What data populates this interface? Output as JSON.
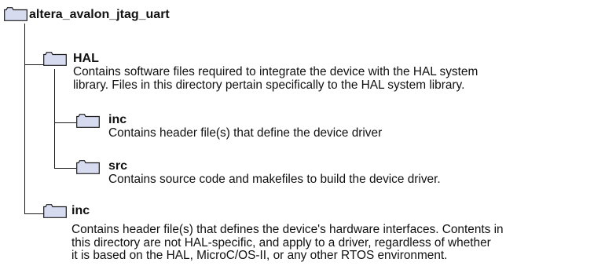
{
  "tree": {
    "root": {
      "title": "altera_avalon_jtag_uart",
      "icon": "folder-icon"
    },
    "hal": {
      "title": "HAL",
      "icon": "folder-icon",
      "desc": [
        "Contains software files required to integrate the device with the HAL system",
        "library.  Files in this directory pertain specifically to the HAL system library."
      ]
    },
    "hal_inc": {
      "title": "inc",
      "icon": "folder-icon",
      "desc": [
        "Contains header file(s) that define the device driver"
      ]
    },
    "hal_src": {
      "title": "src",
      "icon": "folder-icon",
      "desc": [
        "Contains source code and makefiles to build the device driver."
      ]
    },
    "inc": {
      "title": "inc",
      "icon": "folder-icon",
      "desc": [
        "Contains header file(s) that defines the device's hardware interfaces.  Contents in",
        "this directory are not HAL-specific, and apply to a driver, regardless of whether",
        "it is based on the HAL, MicroC/OS-II, or any other RTOS environment."
      ]
    }
  },
  "colors": {
    "folder_fill": "#d7dbef",
    "folder_stroke": "#1a1a1a",
    "line": "#1a1a1a"
  }
}
